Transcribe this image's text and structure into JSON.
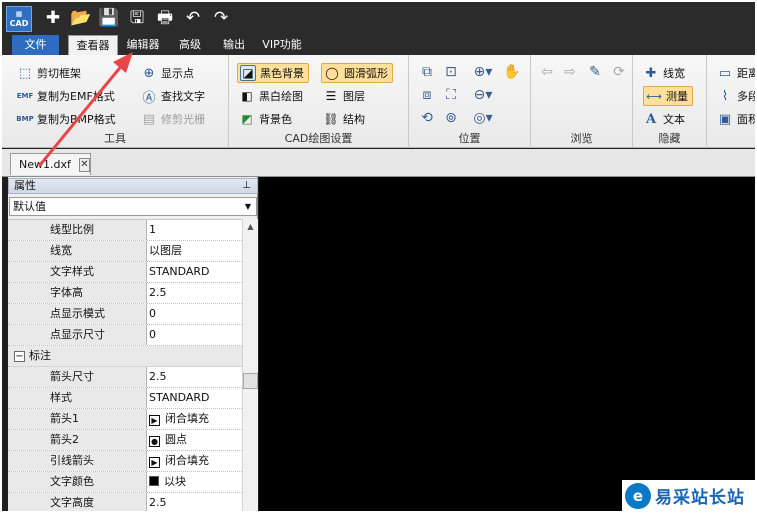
{
  "app": {
    "logo_text": "CAD"
  },
  "quick_access": [
    {
      "name": "new-icon",
      "glyph": "✚"
    },
    {
      "name": "open-folder-icon",
      "glyph": "📂"
    },
    {
      "name": "save-icon",
      "glyph": "💾"
    },
    {
      "name": "save-pdf-icon",
      "glyph": "🖫"
    },
    {
      "name": "print-icon",
      "glyph": "🖶"
    },
    {
      "name": "undo-icon",
      "glyph": "↶"
    },
    {
      "name": "redo-icon",
      "glyph": "↷"
    }
  ],
  "menu": {
    "file": "文件",
    "viewer": "查看器",
    "editor": "编辑器",
    "advanced": "高级",
    "output": "输出",
    "vip": "VIP功能"
  },
  "ribbon": {
    "tools": {
      "title": "工具",
      "clip_frame": "剪切框架",
      "copy_emf": "复制为EMF格式",
      "copy_bmp": "复制为BMP格式",
      "show_points": "显示点",
      "find_text": "查找文字",
      "trim_raster": "修剪光栅"
    },
    "cad_settings": {
      "title": "CAD绘图设置",
      "black_background": "黑色背景",
      "smooth_arc": "圆滑弧形",
      "black_white_drawing": "黑白绘图",
      "layers": "图层",
      "background_color": "背景色",
      "structure": "结构"
    },
    "position": {
      "title": "位置"
    },
    "browse": {
      "title": "浏览"
    },
    "hide": {
      "title": "隐藏",
      "line_width": "线宽",
      "measure": "测量",
      "text": "文本"
    },
    "measure_more": {
      "distance": "距离",
      "polyline": "多段",
      "area": "面积"
    }
  },
  "doc_tab": {
    "filename": "New1.dxf"
  },
  "properties": {
    "title": "属性",
    "pin": "ᵠ",
    "default_value": "默认值",
    "rows": [
      {
        "name": "线型比例",
        "value": "1"
      },
      {
        "name": "线宽",
        "value": "以图层"
      },
      {
        "name": "文字样式",
        "value": "STANDARD"
      },
      {
        "name": "字体高",
        "value": "2.5"
      },
      {
        "name": "点显示模式",
        "value": "0"
      },
      {
        "name": "点显示尺寸",
        "value": "0"
      }
    ],
    "section": {
      "toggle": "−",
      "name": "标注"
    },
    "section_rows": [
      {
        "name": "箭头尺寸",
        "value": "2.5"
      },
      {
        "name": "样式",
        "value": "STANDARD"
      },
      {
        "name": "箭头1",
        "value": "闭合填充",
        "symbol": "▶"
      },
      {
        "name": "箭头2",
        "value": "圆点",
        "symbol": "●"
      },
      {
        "name": "引线箭头",
        "value": "闭合填充",
        "symbol": "▶"
      },
      {
        "name": "文字颜色",
        "value": "以块"
      },
      {
        "name": "文字高度",
        "value": "2.5"
      }
    ]
  },
  "watermark": {
    "text": "易采站长站"
  },
  "colors": {
    "file_menu": "#2d6cc0",
    "canvas": "#000000",
    "annotation_arrow": "#e8474a",
    "highlight": "#ffe09a"
  }
}
